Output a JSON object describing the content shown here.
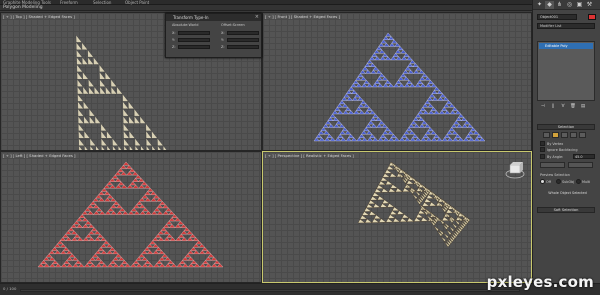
{
  "ribbon": {
    "tabs": [
      "Graphite Modeling Tools",
      "Freeform",
      "Selection",
      "Object Paint"
    ]
  },
  "subbar": {
    "title": "Polygon Modeling"
  },
  "viewports": [
    {
      "label": "[ + ] [ Top ] [ Shaded + Edged Faces ]",
      "color": "#d8d0b4",
      "colorName": "cream"
    },
    {
      "label": "[ + ] [ Front ] [ Shaded + Edged Faces ]",
      "color": "#4b5fd0",
      "colorName": "blue"
    },
    {
      "label": "[ + ] [ Left ] [ Shaded + Edged Faces ]",
      "color": "#d23b3b",
      "colorName": "red"
    },
    {
      "label": "[ + ] [ Perspective ] [ Realistic + Edged Faces ]",
      "color": "#e1d7b4",
      "colorName": "cream"
    }
  ],
  "transform_dialog": {
    "title": "Transform Type-In",
    "absolute_label": "Absolute:World",
    "offset_label": "Offset:Screen",
    "axes": [
      "X:",
      "Y:",
      "Z:"
    ]
  },
  "command_panel": {
    "tabs": [
      "create-icon",
      "modify-icon",
      "hierarchy-icon",
      "motion-icon",
      "display-icon",
      "utilities-icon"
    ],
    "object_name": "Object001",
    "modifier_list": "Modifier List",
    "stack_item": "Editable Poly",
    "selection_rollout": "Selection",
    "by_vertex": "By Vertex",
    "ignore_backfacing": "Ignore Backfacing",
    "by_angle": "By Angle:",
    "threshold": "45.0",
    "preview_selection": "Preview Selection",
    "preview_options": [
      "Off",
      "SubObj",
      "Multi"
    ],
    "whole_selected": "Whole Object Selected",
    "soft_selection": "Soft Selection"
  },
  "status": {
    "frame": "0 / 100"
  },
  "watermark": "pxleyes.com"
}
